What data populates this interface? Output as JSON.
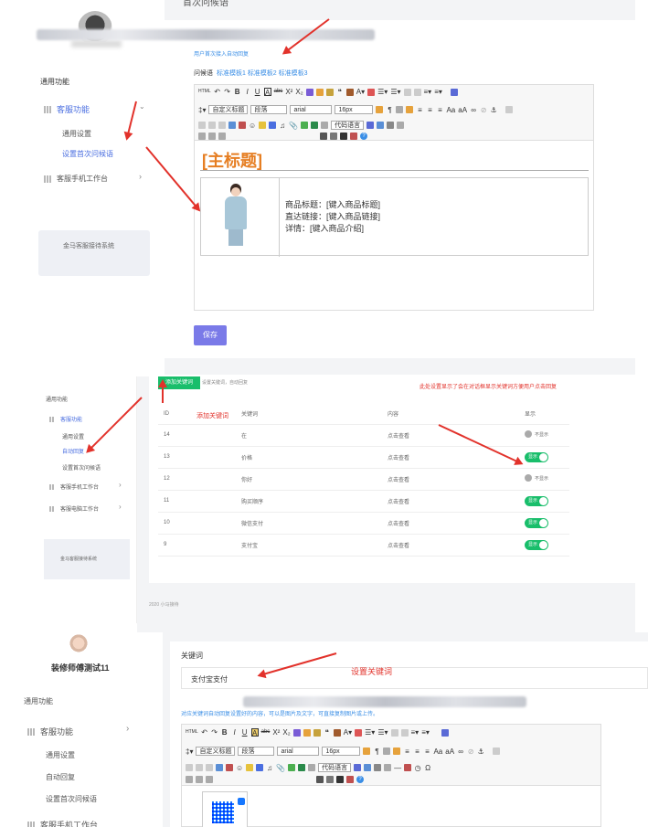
{
  "p1": {
    "page_title": "首次问候语",
    "section": "通用功能",
    "menu_service": "客服功能",
    "sub_general": "通用设置",
    "sub_first": "设置首次问候语",
    "menu_mobile": "客服手机工作台",
    "system_name": "金马客服接待系统",
    "hint": "用户首次接入自动回复",
    "greeting_label": "问候语",
    "templates": [
      "标准模板1",
      "标准模板2",
      "标准模板3"
    ],
    "editor_heading": "[主标题]",
    "product_title": "商品标题：[键入商品标题]",
    "product_link": "直达链接：[键入商品链接]",
    "product_detail": "详情：[键入商品介绍]",
    "save": "保存",
    "tb_style": "自定义标题",
    "tb_para": "段落",
    "tb_font": "arial",
    "tb_size": "16px",
    "tb_code": "代码语言"
  },
  "p2": {
    "add_button": "添加关键词",
    "subtitle": "设置关键词，自动回复",
    "red_note1": "添加关键词",
    "red_note2": "此处设置显示了会在对话框显示关键词方便用户点击回复",
    "section": "通用功能",
    "menu_service": "客服功能",
    "sub_general": "通用设置",
    "sub_auto": "自动回复",
    "sub_first": "设置首次问候语",
    "menu_mobile": "客服手机工作台",
    "menu_pc": "客服电脑工作台",
    "system_name": "金马客服接待系统",
    "headers": [
      "ID",
      "关键词",
      "内容",
      "显示"
    ],
    "rows": [
      {
        "id": "14",
        "kw": "在",
        "content": "点击查看",
        "show": "不显示",
        "on": false
      },
      {
        "id": "13",
        "kw": "价格",
        "content": "点击查看",
        "show": "显示",
        "on": true
      },
      {
        "id": "12",
        "kw": "你好",
        "content": "点击查看",
        "show": "不显示",
        "on": false
      },
      {
        "id": "11",
        "kw": "购买顺序",
        "content": "点击查看",
        "show": "显示",
        "on": true
      },
      {
        "id": "10",
        "kw": "微信支付",
        "content": "点击查看",
        "show": "显示",
        "on": true
      },
      {
        "id": "9",
        "kw": "支付宝",
        "content": "点击查看",
        "show": "显示",
        "on": true
      }
    ],
    "footer": "2020 小马接待"
  },
  "p3": {
    "username": "装修师傅测试11",
    "section": "通用功能",
    "menu_service": "客服功能",
    "sub_general": "通用设置",
    "sub_auto": "自动回复",
    "sub_first": "设置首次问候语",
    "menu_mobile": "客服手机工作台",
    "keyword_label": "关键词",
    "keyword_value": "支付宝支付",
    "red_note": "设置关键词",
    "hint": "对应关键词自动回复设置好的内容，可以是图片及文字，可直接复制图片或上传。",
    "tb_style": "自定义标题",
    "tb_para": "段落",
    "tb_font": "arial",
    "tb_size": "16px",
    "tb_code": "代码语言"
  }
}
